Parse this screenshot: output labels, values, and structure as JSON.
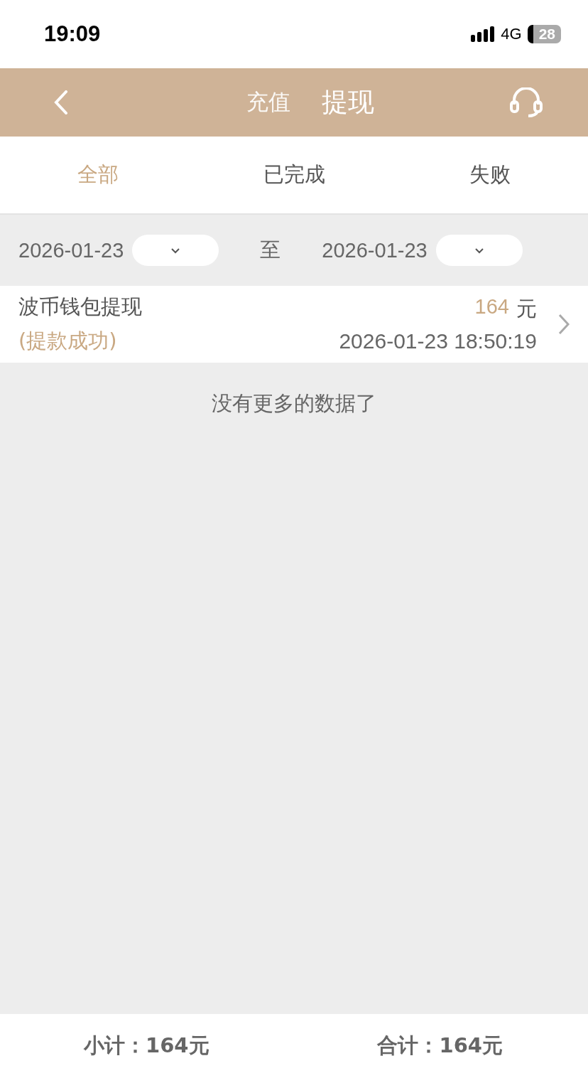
{
  "status_bar": {
    "time": "19:09",
    "network": "4G",
    "battery": "28"
  },
  "header": {
    "tabs": [
      {
        "label": "充值",
        "selected": false
      },
      {
        "label": "提现",
        "selected": true
      }
    ]
  },
  "filter_tabs": [
    {
      "label": "全部",
      "selected": true
    },
    {
      "label": "已完成",
      "selected": false
    },
    {
      "label": "失败",
      "selected": false
    }
  ],
  "date_range": {
    "start": "2026-01-23",
    "separator": "至",
    "end": "2026-01-23"
  },
  "records": [
    {
      "title": "波币钱包提现",
      "status": "(提款成功)",
      "amount": "164",
      "unit": "元",
      "time": "2026-01-23 18:50:19"
    }
  ],
  "end_message": "没有更多的数据了",
  "footer": {
    "subtotal": "小计：164元",
    "total": "合计：164元"
  }
}
